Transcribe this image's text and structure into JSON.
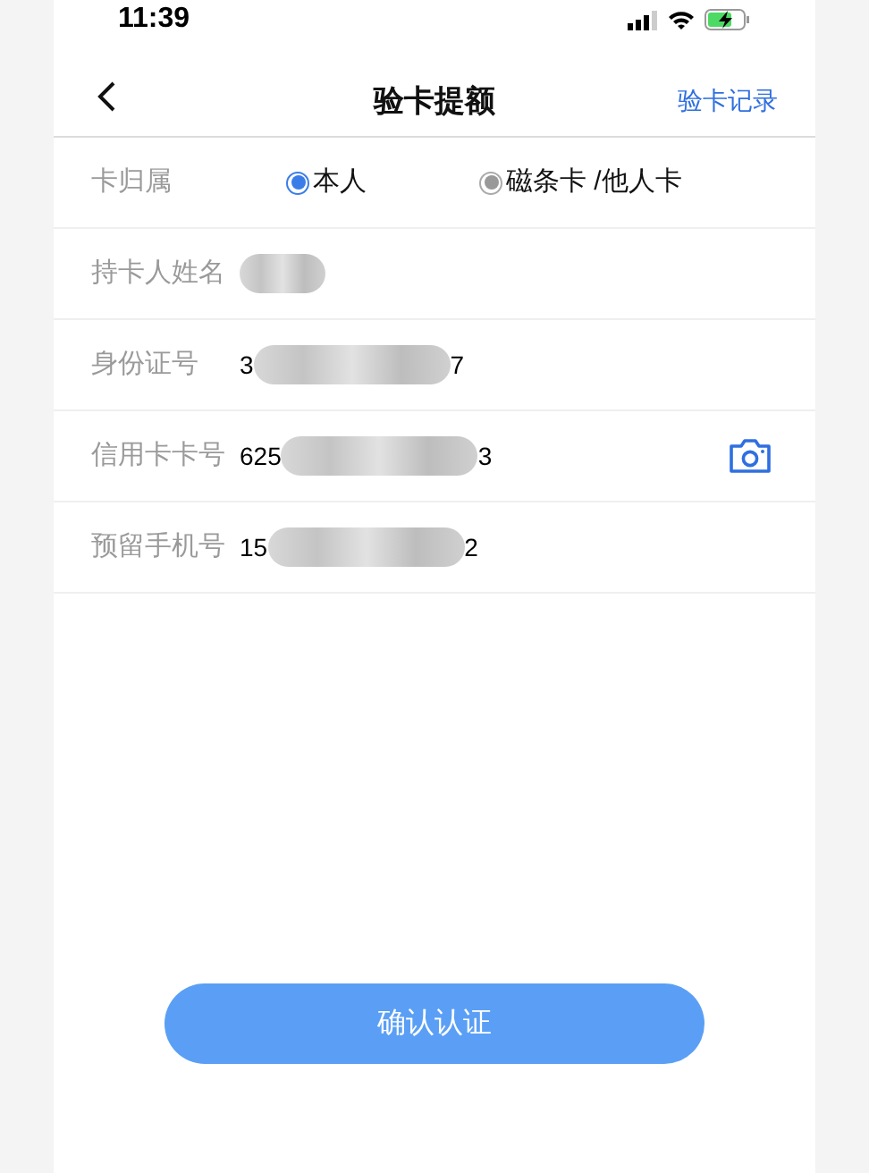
{
  "status_bar": {
    "time": "11:39"
  },
  "header": {
    "title": "验卡提额",
    "action": "验卡记录"
  },
  "form": [
    {
      "kind": "radio",
      "label": "卡归属",
      "options": [
        {
          "label": "本人",
          "selected": true
        },
        {
          "label": "磁条卡 /他人卡",
          "selected": false
        }
      ]
    },
    {
      "kind": "text",
      "label": "持卡人姓名",
      "redacted": true
    },
    {
      "kind": "text",
      "label": "身份证号",
      "value_start": "3",
      "redacted": true,
      "value_end": "7"
    },
    {
      "kind": "text",
      "label": "信用卡卡号",
      "value_start": "625",
      "redacted": true,
      "value_end": "3",
      "scan_button": true
    },
    {
      "kind": "text",
      "label": "预留手机号",
      "value_start": "15",
      "redacted": true,
      "value_end": "2"
    }
  ],
  "confirm_button": "确认认证"
}
